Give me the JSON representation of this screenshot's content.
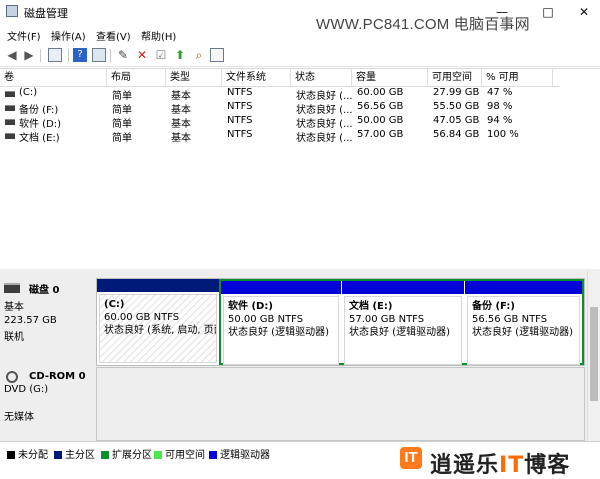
{
  "window": {
    "title": "磁盘管理",
    "watermark": "WWW.PC841.COM 电脑百事网"
  },
  "menu": [
    "文件(F)",
    "操作(A)",
    "查看(V)",
    "帮助(H)"
  ],
  "toolbar": {
    "icons": [
      "back-arrow-icon",
      "forward-arrow-icon",
      "panel-icon",
      "help-icon",
      "properties-icon",
      "connect-icon",
      "delete-icon",
      "check-icon",
      "up-icon",
      "search-icon",
      "window-icon"
    ]
  },
  "volume_table": {
    "headers": [
      "卷",
      "布局",
      "类型",
      "文件系统",
      "状态",
      "容量",
      "可用空间",
      "% 可用"
    ],
    "rows": [
      [
        "(C:)",
        "简单",
        "基本",
        "NTFS",
        "状态良好 (...",
        "60.00 GB",
        "27.99 GB",
        "47 %"
      ],
      [
        "备份 (F:)",
        "简单",
        "基本",
        "NTFS",
        "状态良好 (...",
        "56.56 GB",
        "55.50 GB",
        "98 %"
      ],
      [
        "软件 (D:)",
        "简单",
        "基本",
        "NTFS",
        "状态良好 (...",
        "50.00 GB",
        "47.05 GB",
        "94 %"
      ],
      [
        "文档 (E:)",
        "简单",
        "基本",
        "NTFS",
        "状态良好 (...",
        "57.00 GB",
        "56.84 GB",
        "100 %"
      ]
    ]
  },
  "disk0": {
    "name": "磁盘 0",
    "type": "基本",
    "size": "223.57 GB",
    "status": "联机",
    "partitions": [
      {
        "name": "(C:)",
        "size": "60.00 GB NTFS",
        "status": "状态良好 (系统, 启动, 页面"
      },
      {
        "name": "软件 (D:)",
        "size": "50.00 GB NTFS",
        "status": "状态良好 (逻辑驱动器)"
      },
      {
        "name": "文档 (E:)",
        "size": "57.00 GB NTFS",
        "status": "状态良好 (逻辑驱动器)"
      },
      {
        "name": "备份 (F:)",
        "size": "56.56 GB NTFS",
        "status": "状态良好 (逻辑驱动器)"
      }
    ]
  },
  "cdrom": {
    "name": "CD-ROM 0",
    "drive": "DVD (G:)",
    "status": "无媒体"
  },
  "legend": [
    {
      "label": "未分配",
      "color": "#000000"
    },
    {
      "label": "主分区",
      "color": "#001a7a"
    },
    {
      "label": "扩展分区",
      "color": "#0a8f2a"
    },
    {
      "label": "可用空间",
      "color": "#4de64d"
    },
    {
      "label": "逻辑驱动器",
      "color": "#0000d8"
    }
  ],
  "brand": {
    "mark": "IT",
    "text_start": "逍遥乐",
    "text_it": "IT",
    "text_end": "博客"
  }
}
